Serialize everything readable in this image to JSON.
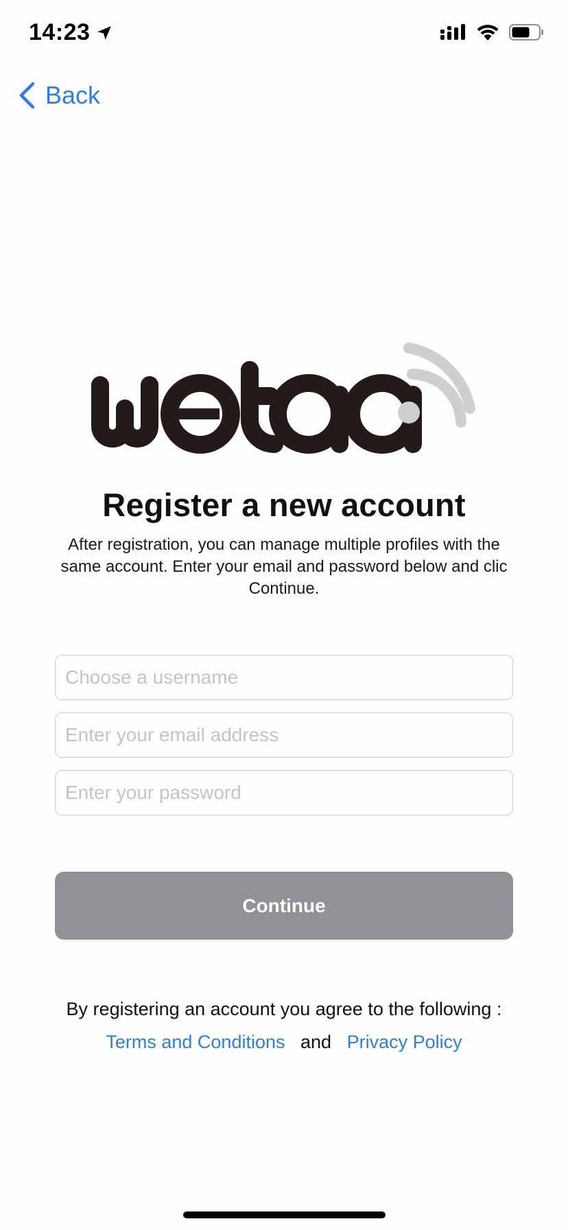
{
  "status_bar": {
    "time": "14:23",
    "location_icon": "location-arrow-icon",
    "signal_icon": "cellular-signal-icon",
    "wifi_icon": "wifi-icon",
    "battery_icon": "battery-icon"
  },
  "nav": {
    "back_label": "Back",
    "back_icon": "chevron-left-icon"
  },
  "logo": {
    "text": "wetaap"
  },
  "header": {
    "title": "Register a new account",
    "subtitle": "After registration, you can manage multiple profiles with the same account. Enter your email and password below and clic Continue."
  },
  "form": {
    "username_placeholder": "Choose a username",
    "username_value": "",
    "email_placeholder": "Enter your email address",
    "email_value": "",
    "password_placeholder": "Enter your password",
    "password_value": "",
    "continue_label": "Continue"
  },
  "footer": {
    "agree_text": "By registering an account you agree to the following :",
    "terms_label": "Terms and Conditions",
    "and_text": "and",
    "privacy_label": "Privacy Policy"
  },
  "colors": {
    "accent": "#2f7ddc",
    "button_disabled": "#919196",
    "logo_dark": "#231a19",
    "logo_waves": "#cfcfcf"
  }
}
